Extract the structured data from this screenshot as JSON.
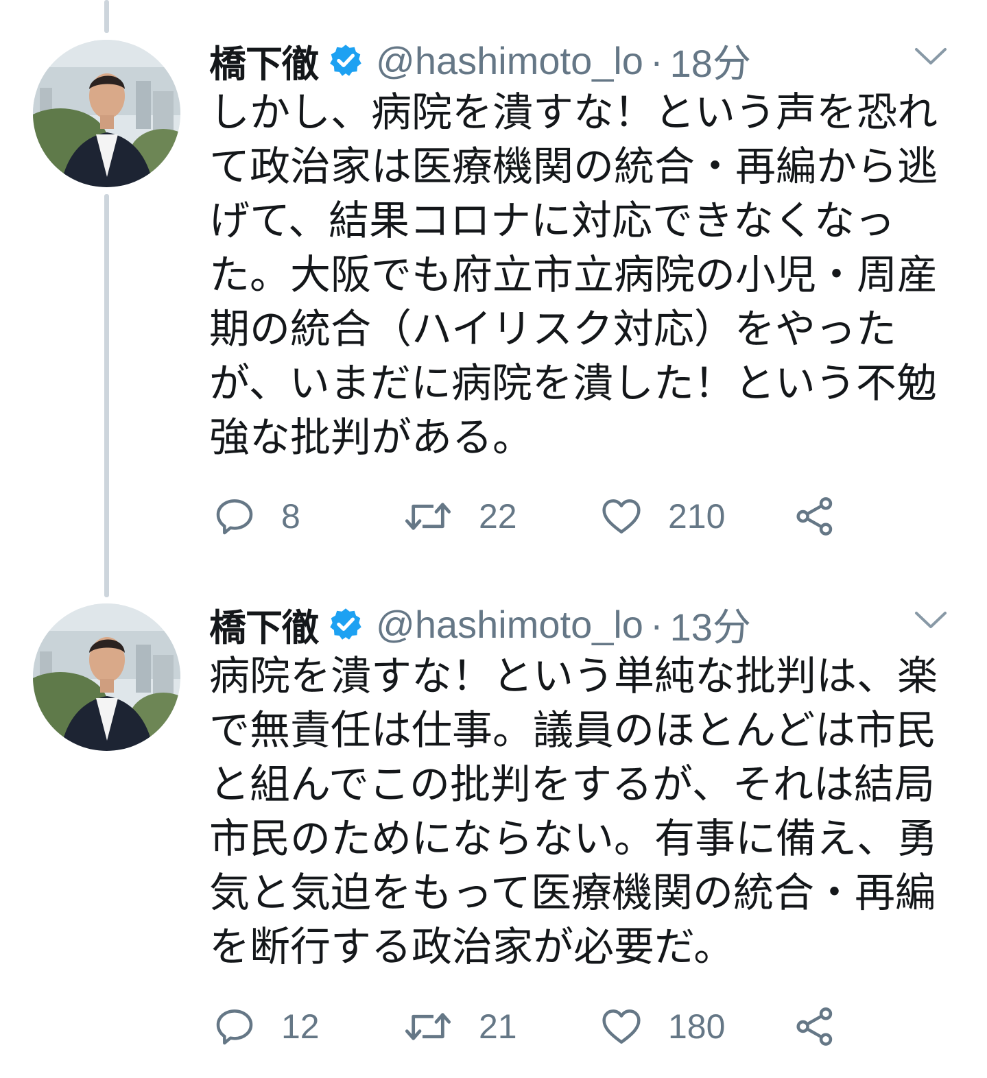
{
  "tweets": [
    {
      "name": "橋下徹",
      "handle": "@hashimoto_lo",
      "separator": "·",
      "time": "18分",
      "text": "しかし、病院を潰すな！という声を恐れて政治家は医療機関の統合・再編から逃げて、結果コロナに対応できなくなった。大阪でも府立市立病院の小児・周産期の統合（ハイリスク対応）をやったが、いまだに病院を潰した！という不勉強な批判がある。",
      "replies": "8",
      "retweets": "22",
      "likes": "210"
    },
    {
      "name": "橋下徹",
      "handle": "@hashimoto_lo",
      "separator": "·",
      "time": "13分",
      "text": "病院を潰すな！という単純な批判は、楽で無責任は仕事。議員のほとんどは市民と組んでこの批判をするが、それは結局市民のためにならない。有事に備え、勇気と気迫をもって医療機関の統合・再編を断行する政治家が必要だ。",
      "replies": "12",
      "retweets": "21",
      "likes": "180"
    }
  ],
  "icons": {
    "verified": "verified-badge-icon",
    "menu": "chevron-down-icon",
    "reply": "reply-icon",
    "retweet": "retweet-icon",
    "like": "heart-icon",
    "share": "share-icon"
  },
  "colors": {
    "verified_blue": "#1da1f2",
    "secondary_text": "#657786",
    "primary_text": "#14171a",
    "thread_line": "#cdd5dc"
  }
}
